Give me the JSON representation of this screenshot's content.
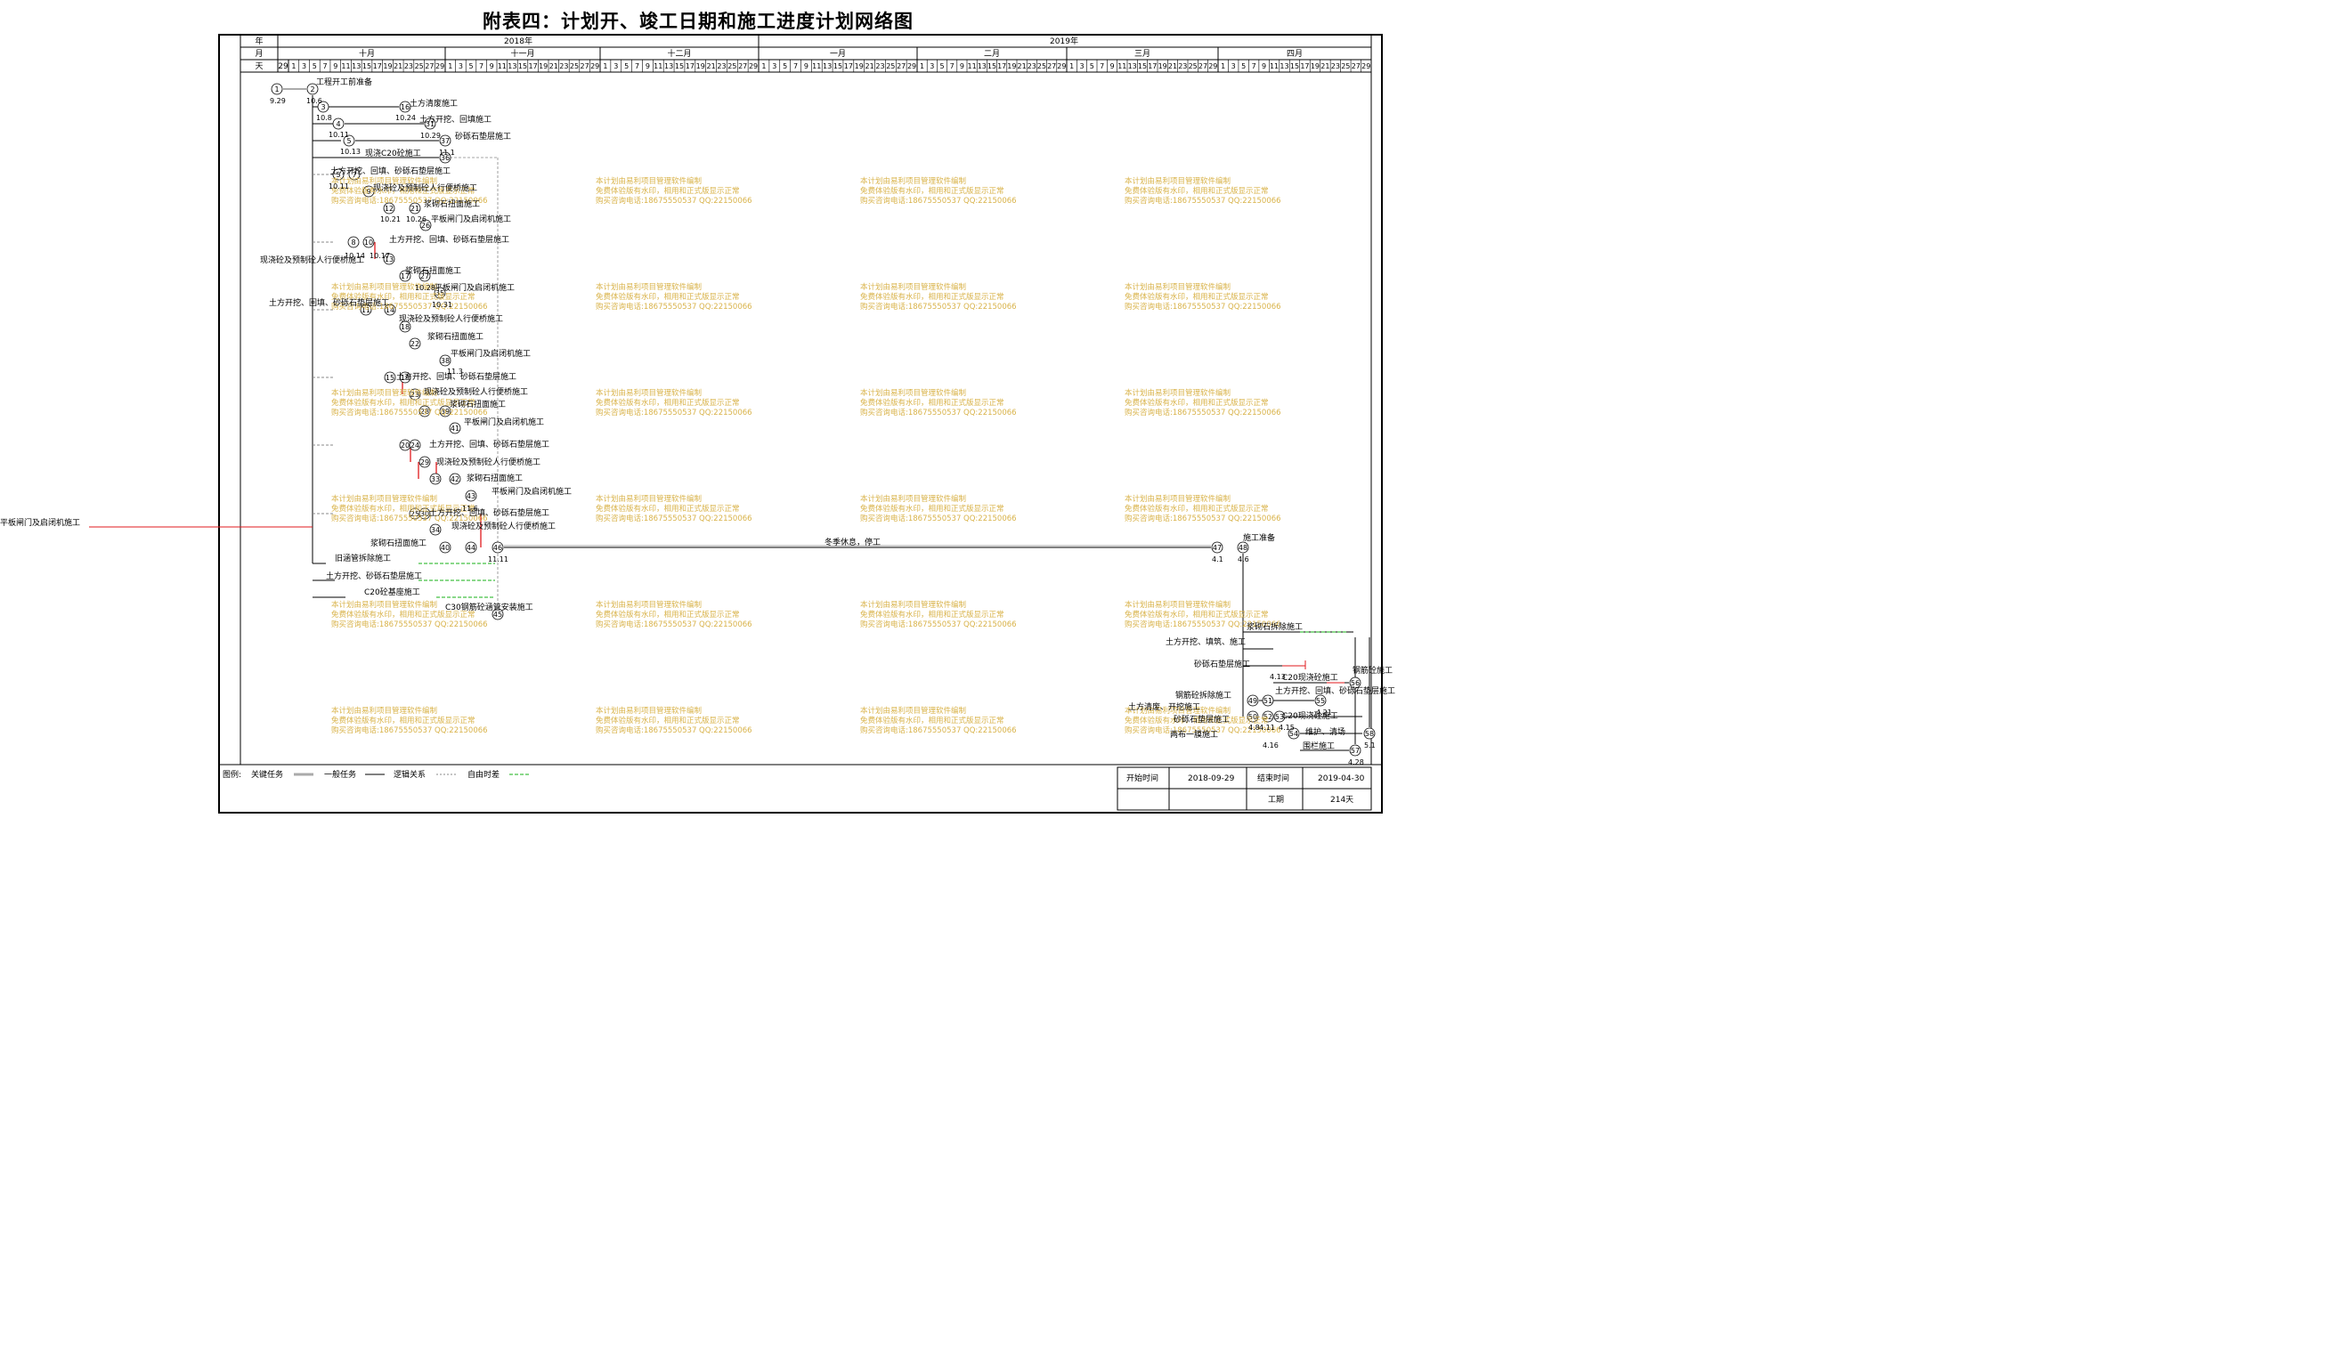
{
  "title": "附表四：计划开、竣工日期和施工进度计划网络图",
  "header": {
    "row_labels": [
      "年",
      "月",
      "天"
    ],
    "years": [
      "2018年",
      "2019年"
    ],
    "months": [
      "十月",
      "十一月",
      "十二月",
      "一月",
      "二月",
      "三月",
      "四月"
    ],
    "day_ticks": [
      "1",
      "3",
      "5",
      "7",
      "9",
      "11",
      "13",
      "15",
      "17",
      "19",
      "21",
      "23",
      "25",
      "27",
      "29"
    ],
    "first_day": "29"
  },
  "network": {
    "outside_label": "平板闸门及启闭机施工",
    "winter_break": "冬季休息，停工",
    "tasks": [
      "工程开工前准备",
      "土方清废施工",
      "土方开挖、回填施工",
      "砂砾石垫层施工",
      "现浇C20砼施工",
      "土方开挖、回填、砂砾石垫层施工",
      "现浇砼及预制砼人行便桥施工",
      "浆砌石扭面施工",
      "平板闸门及启闭机施工",
      "土方开挖、回填、砂砾石垫层施工",
      "现浇砼及预制砼人行便桥施工",
      "浆砌石扭面施工",
      "平板闸门及启闭机施工",
      "土方开挖、回填、砂砾石垫层施工",
      "现浇砼及预制砼人行便桥施工",
      "浆砌石扭面施工",
      "平板闸门及启闭机施工",
      "土方开挖、回填、砂砾石垫层施工",
      "现浇砼及预制砼人行便桥施工",
      "浆砌石扭面施工",
      "平板闸门及启闭机施工",
      "土方开挖、回填、砂砾石垫层施工",
      "现浇砼及预制砼人行便桥施工",
      "浆砌石扭面施工",
      "平板闸门及启闭机施工",
      "土方开挖、回填、砂砾石垫层施工",
      "现浇砼及预制砼人行便桥施工",
      "浆砌石扭面施工",
      "旧涵管拆除施工",
      "土方开挖、砂砾石垫层施工",
      "C20砼基座施工",
      "C30钢筋砼涵管安装施工",
      "施工准备",
      "浆砌石拆除施工",
      "土方开挖、填筑、施工",
      "砂砾石垫层施工",
      "C20现浇砼施工",
      "钢筋砼施工",
      "土方开挖、回填、砂砾石垫层施工",
      "钢筋砼拆除施工",
      "土方清废、开挖施工",
      "C20现浇砼施工",
      "砂砾石垫层施工",
      "维护、清场",
      "两布一膜施工",
      "围栏施工"
    ],
    "dates": [
      "9.29",
      "10.6",
      "10.8",
      "10.11",
      "10.13",
      "10.24",
      "10.29",
      "11.1",
      "10.11",
      "10.14",
      "10.17",
      "10.21",
      "10.26",
      "10.28",
      "10.31",
      "11.3",
      "11.6",
      "11.11",
      "4.1",
      "4.6",
      "4.8",
      "4.11",
      "4.13",
      "4.15",
      "4.16",
      "4.21",
      "4.28",
      "5.1"
    ]
  },
  "watermark": {
    "line1": "本计划由易利项目管理软件编制",
    "line2": "免费体验版有水印，相用和正式版显示正常",
    "line3": "购买咨询电话:18675550537 QQ:22150066"
  },
  "legend": {
    "label": "图例:",
    "items": [
      "关键任务",
      "一般任务",
      "逻辑关系",
      "自由时差"
    ]
  },
  "info": {
    "start_label": "开始时间",
    "start_value": "2018-09-29",
    "end_label": "结束时间",
    "end_value": "2019-04-30",
    "duration_label": "工期",
    "duration_value": "214天"
  },
  "colors": {
    "critical": "#e0191c",
    "free_float": "#16b216",
    "watermark": "#d9b34a",
    "line": "#000000"
  }
}
